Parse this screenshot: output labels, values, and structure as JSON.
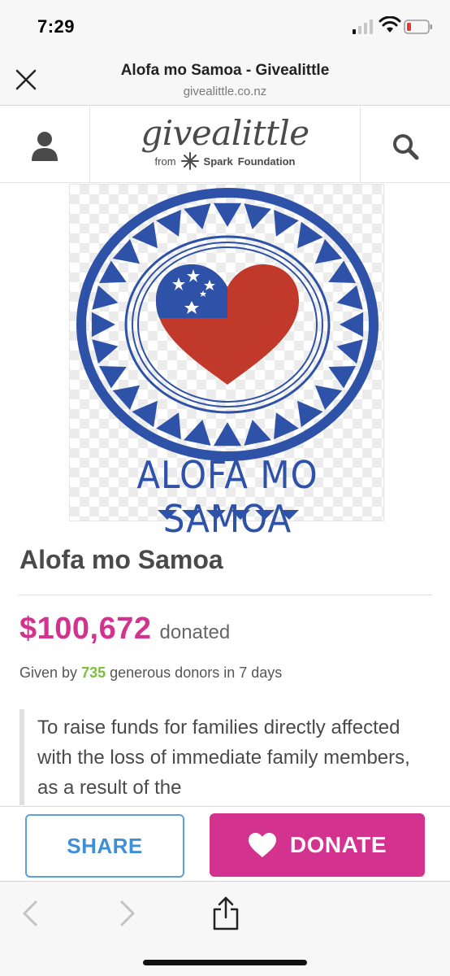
{
  "status_bar": {
    "time": "7:29",
    "icons": [
      "signal-icon",
      "wifi-icon",
      "battery-low-icon"
    ]
  },
  "browser": {
    "page_title": "Alofa mo Samoa - Givealittle",
    "url": "givealittle.co.nz",
    "close_icon": "close-icon"
  },
  "site_header": {
    "logo_word": "givealittle",
    "logo_from": "from",
    "logo_sponsor": "Spark",
    "logo_sponsor_suffix": "Foundation",
    "account_icon": "user-icon",
    "search_icon": "search-icon"
  },
  "campaign_image": {
    "caption": "ALOFA MO SAMOA"
  },
  "campaign": {
    "title": "Alofa mo Samoa",
    "amount": "$100,672",
    "amount_suffix": "donated",
    "donors_prefix": "Given by",
    "donors_count": "735",
    "donors_suffix": "generous donors in 7 days",
    "description": "To raise funds for families directly affected with the loss of immediate family members, as a result of the"
  },
  "actions": {
    "share_label": "SHARE",
    "donate_label": "DONATE"
  },
  "colors": {
    "brand_pink": "#d3338f",
    "share_blue": "#3f8fd8",
    "donor_green": "#7cbf3a",
    "samoa_blue": "#2e52a8",
    "samoa_red": "#c0392b"
  }
}
